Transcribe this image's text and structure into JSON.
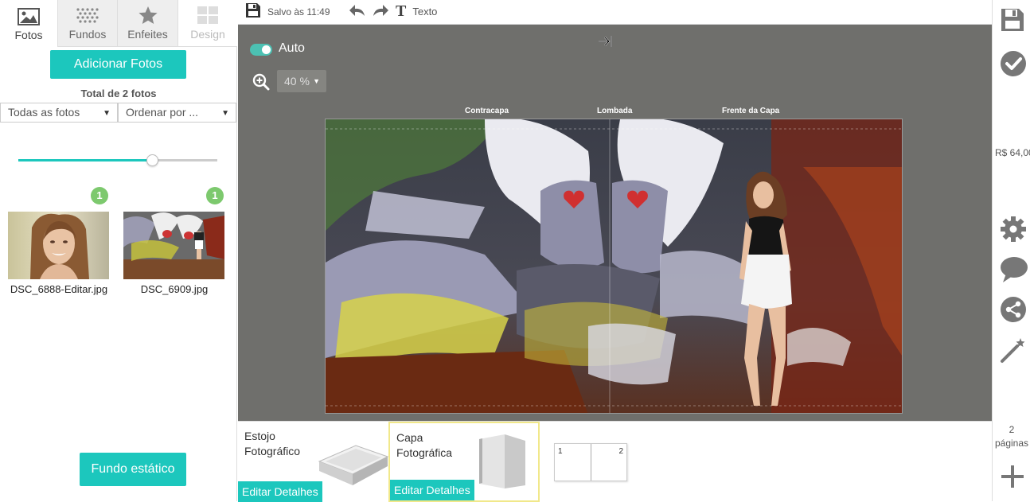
{
  "sidebar": {
    "tabs": [
      {
        "label": "Fotos",
        "icon": "image-icon",
        "state": "active"
      },
      {
        "label": "Fundos",
        "icon": "pattern-icon",
        "state": "normal"
      },
      {
        "label": "Enfeites",
        "icon": "star-icon",
        "state": "normal"
      },
      {
        "label": "Design",
        "icon": "layout-icon",
        "state": "disabled"
      }
    ],
    "add_photos_label": "Adicionar Fotos",
    "total_label": "Total de 2 fotos",
    "filter_value": "Todas as fotos",
    "sort_value": "Ordenar por ...",
    "size_slider_level": 0.67,
    "photos": [
      {
        "name": "DSC_6888-Editar.jpg",
        "use_count": "1"
      },
      {
        "name": "DSC_6909.jpg",
        "use_count": "1"
      }
    ],
    "static_bg_label": "Fundo estático"
  },
  "toolbar": {
    "saved_label": "Salvo às 11:49",
    "text_label": "Texto",
    "text_glyph": "T"
  },
  "canvas": {
    "auto_label": "Auto",
    "auto_on": true,
    "zoom_value": "40 %",
    "sections": {
      "back": "Contracapa",
      "spine": "Lombada",
      "front": "Frente da Capa"
    }
  },
  "bottom": {
    "products": [
      {
        "name": "Estojo Fotográfico",
        "edit_label": "Editar Detalhes"
      },
      {
        "name": "Capa Fotográfica",
        "edit_label": "Editar Detalhes"
      }
    ],
    "page_numbers": [
      "1",
      "2"
    ]
  },
  "rightbar": {
    "price": "R$ 64,00",
    "pages_count": "2",
    "pages_label": "páginas"
  },
  "colors": {
    "accent": "#1cc7bd",
    "canvas_bg": "#6f6f6c",
    "badge": "#7dc96e"
  }
}
